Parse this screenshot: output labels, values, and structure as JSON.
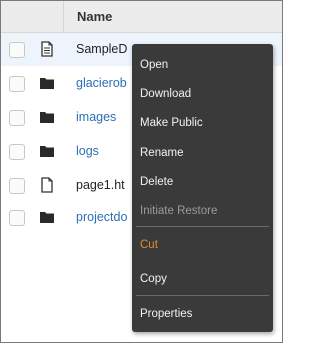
{
  "table": {
    "name_header": "Name",
    "rows": [
      {
        "name": "SampleD",
        "type": "document",
        "selected": true
      },
      {
        "name": "glacierob",
        "type": "folder"
      },
      {
        "name": "images",
        "type": "folder"
      },
      {
        "name": "logs",
        "type": "folder"
      },
      {
        "name": "page1.ht",
        "type": "file"
      },
      {
        "name": "projectdo",
        "type": "folder"
      }
    ]
  },
  "context_menu": {
    "items": [
      {
        "label": "Open",
        "state": "enabled"
      },
      {
        "label": "Download",
        "state": "enabled"
      },
      {
        "label": "Make Public",
        "state": "enabled"
      },
      {
        "label": "Rename",
        "state": "enabled"
      },
      {
        "label": "Delete",
        "state": "enabled"
      },
      {
        "label": "Initiate Restore",
        "state": "disabled"
      },
      {
        "label": "Cut",
        "state": "highlighted"
      },
      {
        "label": "Copy",
        "state": "enabled"
      },
      {
        "label": "Properties",
        "state": "enabled"
      }
    ]
  },
  "colors": {
    "menu_background": "#3a3a3a",
    "folder_link": "#2b6fb6",
    "highlight": "#e38a2e"
  }
}
